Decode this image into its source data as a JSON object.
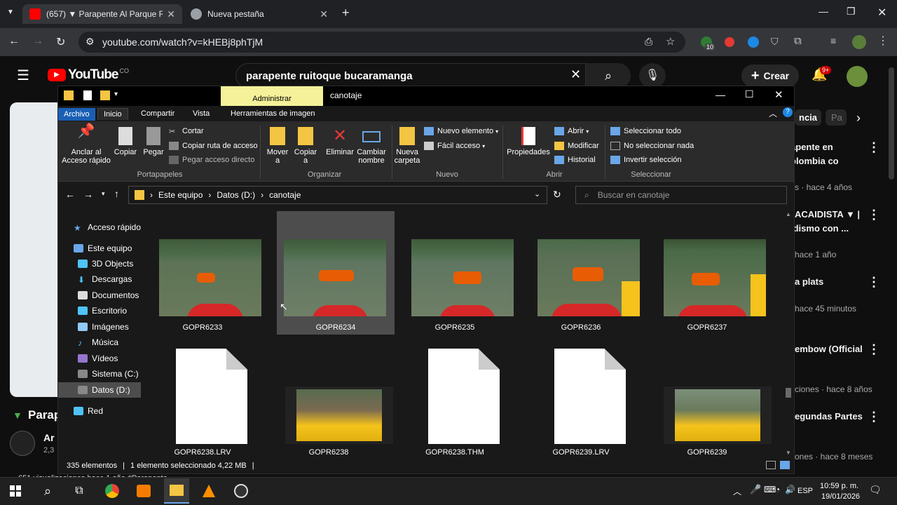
{
  "browser": {
    "tabs": [
      {
        "label": "(657) ▼ Parapente Al Parque R",
        "active": true
      },
      {
        "label": "Nueva pestaña",
        "active": false
      }
    ],
    "url": "youtube.com/watch?v=kHEBj8phTjM",
    "ext_badge": "10"
  },
  "youtube": {
    "logo": "YouTube",
    "country": "CO",
    "search_value": "parapente ruitoque bucaramanga",
    "create_label": "Crear",
    "notif_badge": "9+",
    "chips": [
      "ncia",
      "Pa"
    ],
    "sidebar": [
      {
        "title": "apente en",
        "title2": "olombia co",
        "meta": "s · hace 4 años"
      },
      {
        "title": "ACAIDISTA ▼ |",
        "title2": "idismo con ...",
        "meta": "hace 1 año"
      },
      {
        "title": "a plats",
        "title2": "",
        "meta": "hace 45 minutos"
      },
      {
        "title": "embow (Official",
        "title2": "",
        "meta": "ciones · hace 8 años"
      },
      {
        "title": "egundas Partes",
        "title2": "",
        "meta": "ones · hace 8 meses"
      }
    ],
    "video_title_partial": "Parap",
    "channel_partial": "Ar",
    "channel_subs_partial": "2,3",
    "views_partial": "651 visualizaciones  hace 1 año  #Parapente"
  },
  "explorer": {
    "title": "canotaje",
    "admin_label": "Administrar",
    "ribbon_tabs": [
      "Archivo",
      "Inicio",
      "Compartir",
      "Vista",
      "Herramientas de imagen"
    ],
    "ribbon": {
      "anclar": "Anclar al Acceso rápido",
      "copiar": "Copiar",
      "pegar": "Pegar",
      "cortar": "Cortar",
      "copiar_ruta": "Copiar ruta de acceso",
      "pegar_acceso": "Pegar acceso directo",
      "mover": "Mover a",
      "copiar_a": "Copiar a",
      "eliminar": "Eliminar",
      "cambiar": "Cambiar nombre",
      "nueva_carpeta": "Nueva carpeta",
      "nuevo_elemento": "Nuevo elemento",
      "facil_acceso": "Fácil acceso",
      "propiedades": "Propiedades",
      "abrir": "Abrir",
      "modificar": "Modificar",
      "historial": "Historial",
      "sel_todo": "Seleccionar todo",
      "no_sel": "No seleccionar nada",
      "invertir": "Invertir selección",
      "groups": [
        "Portapapeles",
        "Organizar",
        "Nuevo",
        "Abrir",
        "Seleccionar"
      ]
    },
    "breadcrumb": [
      "Este equipo",
      "Datos (D:)",
      "canotaje"
    ],
    "search_placeholder": "Buscar en canotaje",
    "nav": [
      "Acceso rápido",
      "Este equipo",
      "3D Objects",
      "Descargas",
      "Documentos",
      "Escritorio",
      "Imágenes",
      "Música",
      "Vídeos",
      "Sistema (C:)",
      "Datos (D:)",
      "Red"
    ],
    "files": [
      {
        "name": "GOPR6233",
        "kind": "photo"
      },
      {
        "name": "GOPR6234",
        "kind": "photo"
      },
      {
        "name": "GOPR6235",
        "kind": "photo"
      },
      {
        "name": "GOPR6236",
        "kind": "photo"
      },
      {
        "name": "GOPR6237",
        "kind": "photo"
      },
      {
        "name": "GOPR6238.LRV",
        "kind": "doc"
      },
      {
        "name": "GOPR6238",
        "kind": "video"
      },
      {
        "name": "GOPR6238.THM",
        "kind": "doc"
      },
      {
        "name": "GOPR6239.LRV",
        "kind": "doc"
      },
      {
        "name": "GOPR6239",
        "kind": "video"
      }
    ],
    "status": {
      "count": "335 elementos",
      "selected": "1 elemento seleccionado  4,22 MB"
    }
  },
  "taskbar": {
    "lang": "ESP",
    "time": "10:59 p. m.",
    "date": "19/01/2026"
  }
}
